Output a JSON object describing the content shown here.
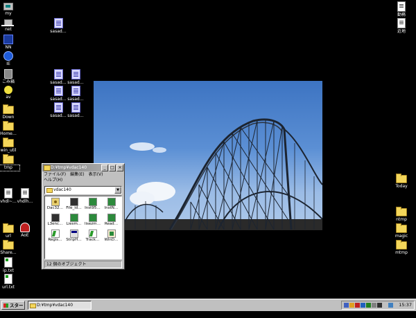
{
  "desktop_left": [
    {
      "label": "my",
      "icon": "my-computer-icon",
      "kind": "pc",
      "boxed": false
    },
    {
      "label": "net",
      "icon": "network-icon",
      "kind": "net",
      "boxed": false
    },
    {
      "label": "NN",
      "icon": "netscape-icon",
      "kind": "nn",
      "boxed": false
    },
    {
      "label": "IE",
      "icon": "ie-icon",
      "kind": "ie",
      "boxed": false
    },
    {
      "label": "ごみ箱",
      "icon": "recycle-bin-icon",
      "kind": "trash",
      "boxed": false
    },
    {
      "label": "av",
      "icon": "av-icon",
      "kind": "av",
      "boxed": false
    },
    {
      "label": "Down",
      "icon": "folder-icon",
      "kind": "folder",
      "boxed": false
    },
    {
      "label": "Home…",
      "icon": "folder-icon",
      "kind": "folder",
      "boxed": false
    },
    {
      "label": "win_util",
      "icon": "folder-icon",
      "kind": "folder",
      "boxed": false
    },
    {
      "label": "tmp",
      "icon": "folder-icon",
      "kind": "folder",
      "boxed": true
    },
    {
      "label": "vhdl~…",
      "icon": "document-icon",
      "kind": "doc",
      "boxed": false
    },
    {
      "label": "url",
      "icon": "folder-icon",
      "kind": "folder",
      "boxed": false
    },
    {
      "label": "Share…",
      "icon": "folder-icon",
      "kind": "folder",
      "boxed": false
    },
    {
      "label": "ip.txt",
      "icon": "text-file-icon",
      "kind": "txt",
      "boxed": false
    },
    {
      "label": "url.txt",
      "icon": "text-file-icon",
      "kind": "txt",
      "boxed": false
    }
  ],
  "desktop_mid": [
    {
      "label": "vhdlh…",
      "icon": "document-icon",
      "kind": "doc"
    },
    {
      "label": "AoE",
      "icon": "aoe-icon",
      "kind": "aoe"
    },
    {
      "label": "sasad…",
      "icon": "sasad-file-icon",
      "kind": "sasad"
    },
    {
      "label": "sasad…",
      "icon": "sasad-file-icon",
      "kind": "sasad"
    },
    {
      "label": "sasad…",
      "icon": "sasad-file-icon",
      "kind": "sasad"
    },
    {
      "label": "sasad…",
      "icon": "sasad-file-icon",
      "kind": "sasad"
    },
    {
      "label": "sasad…",
      "icon": "sasad-file-icon",
      "kind": "sasad"
    },
    {
      "label": "sasad…",
      "icon": "sasad-file-icon",
      "kind": "sasad"
    },
    {
      "label": "sasad…",
      "icon": "sasad-file-icon",
      "kind": "sasad"
    }
  ],
  "desktop_right": [
    {
      "label": "勤務",
      "icon": "document-icon",
      "kind": "doc"
    },
    {
      "label": "近地",
      "icon": "document-icon",
      "kind": "doc"
    },
    {
      "label": "Today",
      "icon": "folder-icon",
      "kind": "folder"
    },
    {
      "label": "ntmp",
      "icon": "folder-icon",
      "kind": "folder"
    },
    {
      "label": "magic",
      "icon": "folder-icon",
      "kind": "folder"
    },
    {
      "label": "mtmp",
      "icon": "folder-icon",
      "kind": "folder"
    }
  ],
  "explorer": {
    "title": "D:¥tmp¥vdac140",
    "min": "_",
    "max": "□",
    "close": "×",
    "menu": [
      "ファイル(F)",
      "編集(E)",
      "表示(V)",
      "ヘルプ(H)"
    ],
    "address": "vdac140",
    "files": [
      {
        "label": "Dac32…",
        "kind": "gear",
        "icon": "dll-file-icon"
      },
      {
        "label": "File_id…",
        "kind": "dark",
        "icon": "file-id-icon"
      },
      {
        "label": "Inst95…",
        "kind": "green",
        "icon": "installer-icon"
      },
      {
        "label": "InstN…",
        "kind": "green",
        "icon": "installer-icon"
      },
      {
        "label": "L3enc…",
        "kind": "dark",
        "icon": "app-icon"
      },
      {
        "label": "Liesm…",
        "kind": "green",
        "icon": "installer-icon"
      },
      {
        "label": "lisezm…",
        "kind": "green",
        "icon": "installer-icon"
      },
      {
        "label": "Read…",
        "kind": "green",
        "icon": "installer-icon"
      },
      {
        "label": "Regis…",
        "kind": "wave",
        "icon": "registry-file-icon"
      },
      {
        "label": "StripH…",
        "kind": "win2",
        "icon": "window-app-icon"
      },
      {
        "label": "Track…",
        "kind": "wave",
        "icon": "track-file-icon"
      },
      {
        "label": "WinD…",
        "kind": "scroll",
        "icon": "document-icon"
      }
    ],
    "status": "12 個のオブジェクト"
  },
  "taskbar": {
    "start_label": "スタート",
    "task_label": "D:¥tmp¥vdac140",
    "clock": "15:37",
    "tray_colors": [
      "#4060c0",
      "#e0a020",
      "#c02020",
      "#2060c0",
      "#208020",
      "#808080",
      "#303030",
      "#c0c0c0",
      "#4080c0"
    ]
  }
}
